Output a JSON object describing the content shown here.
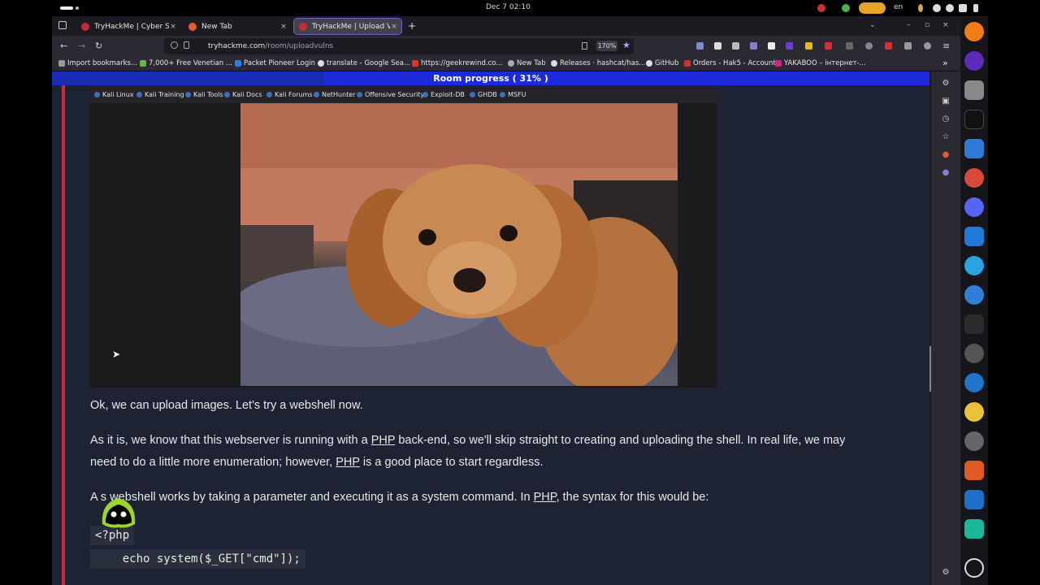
{
  "system_bar": {
    "clock": "Dec 7  02:10",
    "language": "en"
  },
  "tabs": [
    {
      "title": "TryHackMe | Cyber Securi",
      "color": "#c42b3c",
      "active": false
    },
    {
      "title": "New Tab",
      "color": "#e55b2d",
      "active": false
    },
    {
      "title": "TryHackMe | Upload Vuln",
      "color": "#c42b3c",
      "active": true
    }
  ],
  "tab_close": "×",
  "new_tab_label": "+",
  "window_controls": [
    "–",
    "▫",
    "×"
  ],
  "nav": {
    "back": "←",
    "forward": "→",
    "reload": "↻"
  },
  "url": {
    "domain": "tryhackme.com",
    "path": "/room/uploadvulns",
    "zoom": "170%"
  },
  "bookmarks": [
    {
      "label": "Import bookmarks...",
      "color": "#999"
    },
    {
      "label": "7,000+ Free Venetian ...",
      "color": "#6bb34a"
    },
    {
      "label": "Packet Pioneer Login",
      "color": "#2a7de1"
    },
    {
      "label": "translate - Google Sea...",
      "color": "#ddd"
    },
    {
      "label": "https://geekrewind.co...",
      "color": "#d33"
    },
    {
      "label": "New Tab",
      "color": "#aaa"
    },
    {
      "label": "Releases · hashcat/has...",
      "color": "#ddd"
    },
    {
      "label": "GitHub",
      "color": "#ddd"
    },
    {
      "label": "Orders - Hak5 - Account",
      "color": "#c33"
    },
    {
      "label": "YAKABOO – інтернет-...",
      "color": "#d3208a"
    }
  ],
  "progress": {
    "label": "Room progress ( 31% )",
    "percent": 31
  },
  "inner_screenshot": {
    "bookmarks": [
      "Kali Linux",
      "Kali Training",
      "Kali Tools",
      "Kali Docs",
      "Kali Forums",
      "NetHunter",
      "Offensive Security",
      "Exploit-DB",
      "GHDB",
      "MSFU"
    ]
  },
  "content": {
    "p1": "Ok, we can upload images. Let's try a webshell now.",
    "p2_a": "As it is, we know that this webserver is running with a ",
    "p2_php1": "PHP",
    "p2_b": " back-end, so we'll skip straight to creating and uploading the shell. In real life, we may",
    "p2_c": "need to do a little more enumeration; however, ",
    "p2_php2": "PHP",
    "p2_d": " is a good place to start regardless.",
    "p3_a": "A s",
    "p3_b": " webshell works by taking a parameter and executing it as a system command. In ",
    "p3_php": "PHP",
    "p3_c": ", the syntax for this would be:",
    "code_line1": "<?php",
    "code_line2": "    echo system($_GET[\"cmd\"]);"
  },
  "colors": {
    "accent": "#1c2ad9",
    "thm_red": "#c42b3c",
    "page_bg": "#1d2332"
  }
}
